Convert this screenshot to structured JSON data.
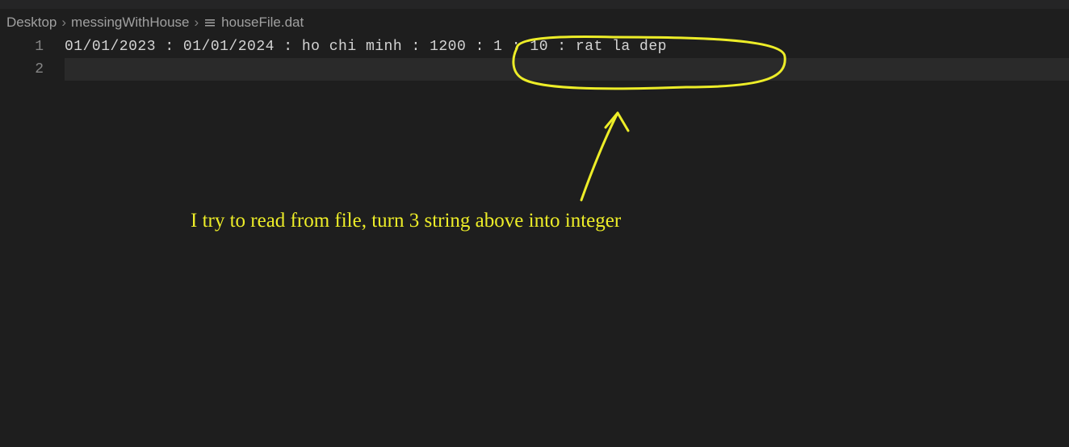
{
  "breadcrumb": {
    "items": [
      "Desktop",
      "messingWithHouse",
      "houseFile.dat"
    ]
  },
  "editor": {
    "lines": [
      {
        "number": "1",
        "content": "01/01/2023 : 01/01/2024 : ho chi minh : 1200 : 1 : 10 : rat la dep"
      },
      {
        "number": "2",
        "content": ""
      }
    ]
  },
  "annotation": {
    "text": "I try to read from file, turn 3 string above into integer"
  }
}
